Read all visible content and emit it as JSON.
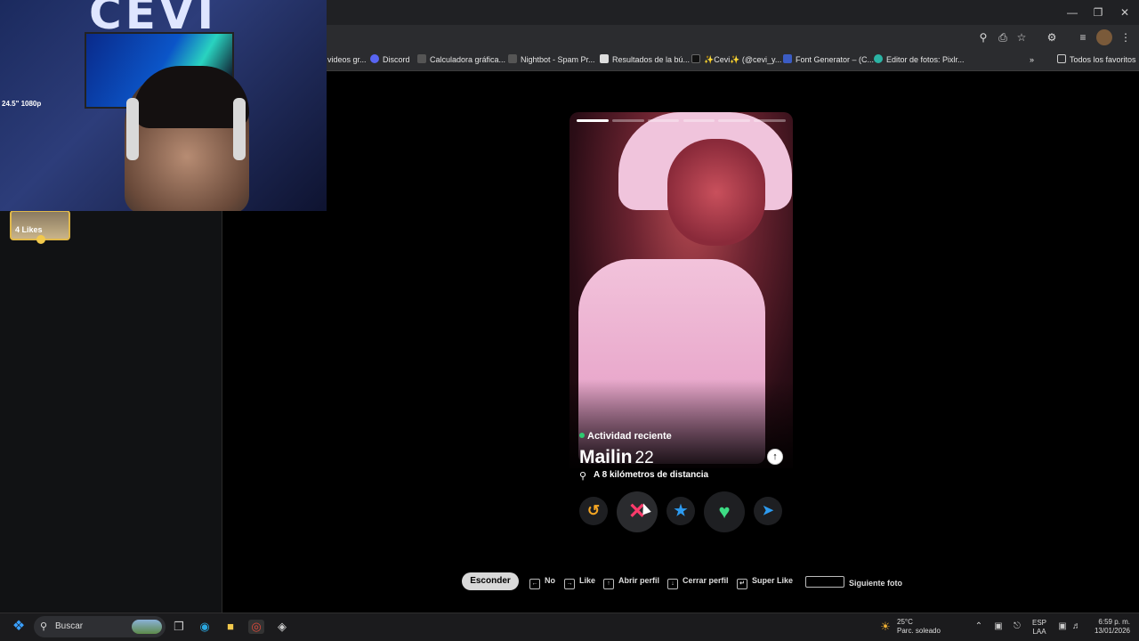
{
  "browser": {
    "bookmarks": [
      {
        "label": "videos gr...",
        "color": "#888888"
      },
      {
        "label": "Discord",
        "color": "#5865f2"
      },
      {
        "label": "Calculadora gráfica...",
        "color": "#555555"
      },
      {
        "label": "Nightbot - Spam Pr...",
        "color": "#555555"
      },
      {
        "label": "Resultados de la bú...",
        "color": "#dddddd"
      },
      {
        "label": "✨Cevi✨ (@cevi_y...",
        "color": "#111111"
      },
      {
        "label": "Font Generator – (C...",
        "color": "#3b5cc4"
      },
      {
        "label": "Editor de fotos: Pixlr...",
        "color": "#2bb3a4"
      }
    ],
    "all_bookmarks": "Todos los favoritos"
  },
  "webcam": {
    "label": "24.5\" 1080p"
  },
  "sidebar": {
    "likes": "4 Likes"
  },
  "profile": {
    "activity": "Actividad reciente",
    "name": "Mailin",
    "age": "22",
    "distance": "A 8 kilómetros de distancia",
    "photo_count": 6,
    "current_photo": 1
  },
  "shortcuts": {
    "hide": "Esconder",
    "no": "No",
    "like": "Like",
    "open": "Abrir perfil",
    "close": "Cerrar perfil",
    "super": "Super Like",
    "next": "Siguiente foto"
  },
  "taskbar": {
    "search": "Buscar",
    "temp": "25°C",
    "weather": "Parc. soleado",
    "lang": "ESP",
    "region": "LAA",
    "time": "6:59 p. m.",
    "date": "13/01/2026"
  },
  "colors": {
    "nope": "#ff3b6b",
    "like": "#3ddc84",
    "super": "#2d9bf0",
    "rewind": "#f5a623"
  }
}
